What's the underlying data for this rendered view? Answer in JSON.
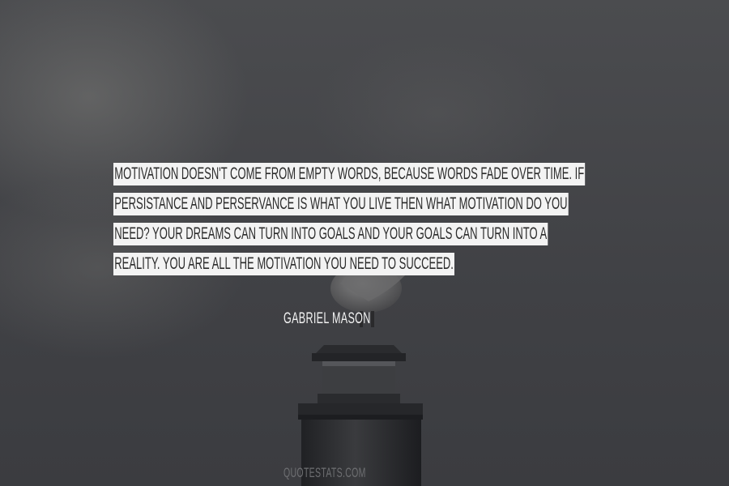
{
  "quote": {
    "lines": [
      "Motivation doesn't come from empty words, because words fade over time. If",
      "persistance and perservance is what you live then what motivation do you",
      "need? Your dreams can turn into goals and your goals can turn into a",
      "reality. You are all the motivation you need to succeed."
    ]
  },
  "author": "Gabriel Mason",
  "site": "QUOTESTATS.COM"
}
